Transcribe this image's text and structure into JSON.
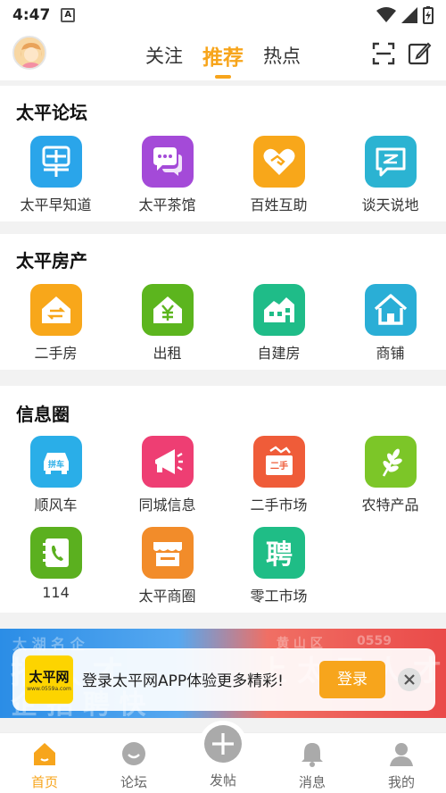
{
  "status": {
    "time": "4:47",
    "app_badge": "A"
  },
  "header": {
    "tabs": [
      {
        "label": "关注"
      },
      {
        "label": "推荐"
      },
      {
        "label": "热点"
      }
    ],
    "active_tab": "推荐"
  },
  "sections": [
    {
      "title": "太平论坛",
      "items": [
        {
          "label": "太平早知道",
          "color": "#2aa5ea",
          "icon": "early-news-icon"
        },
        {
          "label": "太平茶馆",
          "color": "#a44ad8",
          "icon": "chat-bubbles-icon"
        },
        {
          "label": "百姓互助",
          "color": "#f8a71a",
          "icon": "handshake-heart-icon"
        },
        {
          "label": "谈天说地",
          "color": "#2bb3d2",
          "icon": "speech-bubble-icon"
        }
      ]
    },
    {
      "title": "太平房产",
      "items": [
        {
          "label": "二手房",
          "color": "#f8a71a",
          "icon": "house-exchange-icon"
        },
        {
          "label": "出租",
          "color": "#5cb51e",
          "icon": "house-rent-icon"
        },
        {
          "label": "自建房",
          "color": "#1fbc88",
          "icon": "villa-icon"
        },
        {
          "label": "商铺",
          "color": "#2aaed6",
          "icon": "shop-house-icon"
        }
      ]
    },
    {
      "title": "信息圈",
      "items": [
        {
          "label": "顺风车",
          "color": "#2aaee8",
          "icon": "carpool-icon",
          "badge": "拼车"
        },
        {
          "label": "同城信息",
          "color": "#ee3e73",
          "icon": "megaphone-icon"
        },
        {
          "label": "二手市场",
          "color": "#ef5c39",
          "icon": "secondhand-box-icon",
          "badge": "二手"
        },
        {
          "label": "农特产品",
          "color": "#7cc628",
          "icon": "wheat-icon"
        },
        {
          "label": "114",
          "color": "#5bb01f",
          "icon": "phonebook-icon"
        },
        {
          "label": "太平商圈",
          "color": "#f28c2a",
          "icon": "storefront-icon"
        },
        {
          "label": "零工市场",
          "color": "#1fbd86",
          "icon": "hiring-icon",
          "badge": "聘"
        }
      ]
    }
  ],
  "promo": {
    "logo_main": "太平网",
    "logo_sub": "www.0559a.com",
    "text": "登录太平网APP体验更多精彩!",
    "button": "登录"
  },
  "nav": [
    {
      "label": "首页",
      "icon": "home-icon",
      "active": true
    },
    {
      "label": "论坛",
      "icon": "forum-icon",
      "active": false
    },
    {
      "label": "发帖",
      "icon": "plus-icon",
      "active": false
    },
    {
      "label": "消息",
      "icon": "bell-icon",
      "active": false
    },
    {
      "label": "我的",
      "icon": "user-icon",
      "active": false
    }
  ],
  "colors": {
    "accent": "#f7a51c",
    "background": "#f2f2f2"
  }
}
